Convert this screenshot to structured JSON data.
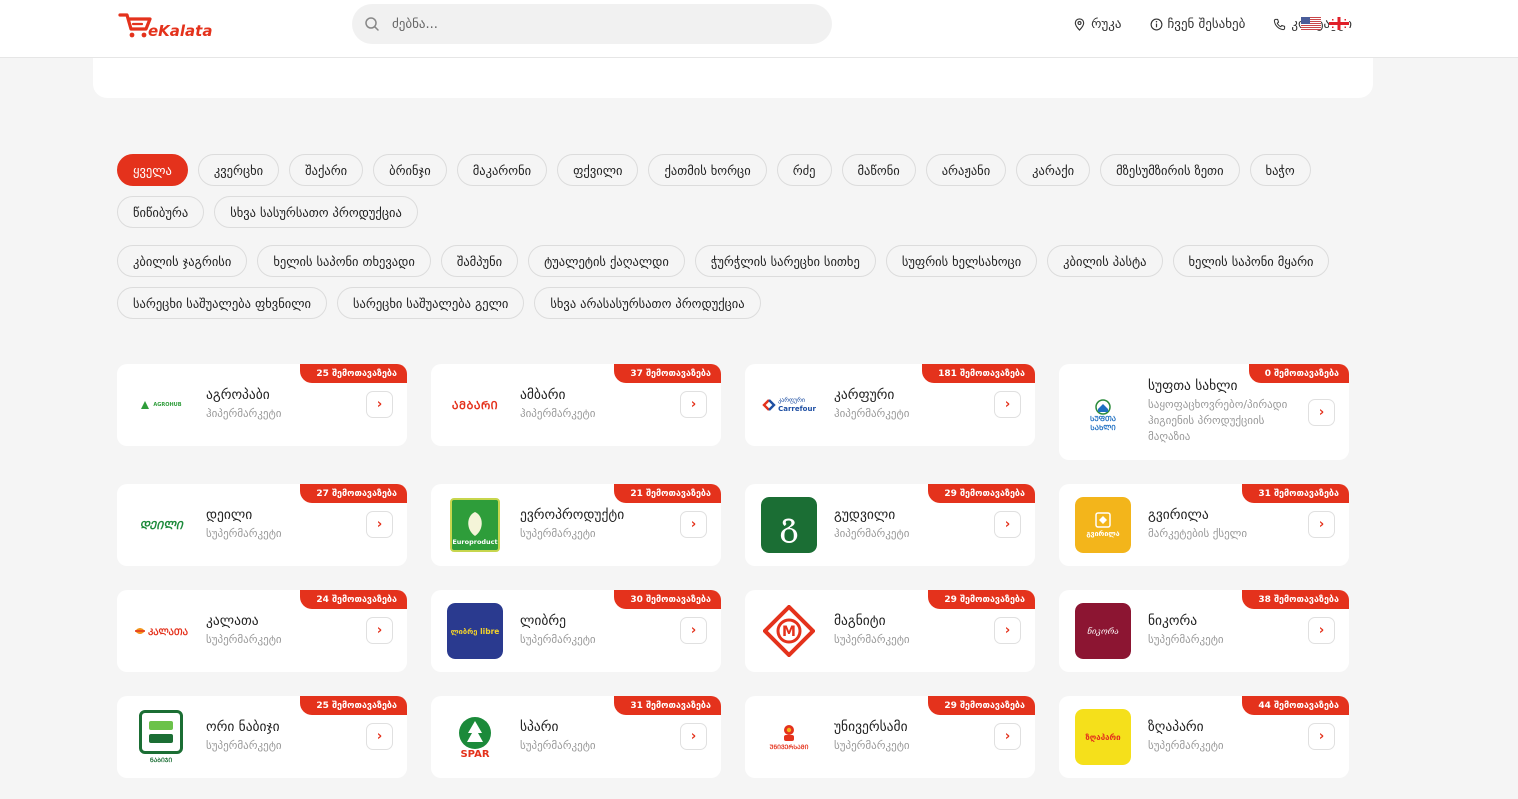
{
  "header": {
    "brand": "eKalata",
    "search_placeholder": "ძებნა...",
    "nav": [
      {
        "label": "რუკა",
        "icon": "map-pin-icon"
      },
      {
        "label": "ჩვენ შესახებ",
        "icon": "info-icon"
      },
      {
        "label": "კონტაქტი",
        "icon": "phone-icon"
      }
    ],
    "languages": [
      "en-flag-icon",
      "ge-flag-icon"
    ]
  },
  "colors": {
    "accent": "#e4321c",
    "background": "#f5f5f5"
  },
  "food_categories": [
    {
      "label": "ყველა",
      "active": true
    },
    {
      "label": "კვერცხი"
    },
    {
      "label": "შაქარი"
    },
    {
      "label": "ბრინჯი"
    },
    {
      "label": "მაკარონი"
    },
    {
      "label": "ფქვილი"
    },
    {
      "label": "ქათმის ხორცი"
    },
    {
      "label": "რძე"
    },
    {
      "label": "მაწონი"
    },
    {
      "label": "არაჟანი"
    },
    {
      "label": "კარაქი"
    },
    {
      "label": "მზესუმზირის ზეთი"
    },
    {
      "label": "ხაჭო"
    },
    {
      "label": "წიწიბურა"
    },
    {
      "label": "სხვა სასურსათო პროდუქცია"
    }
  ],
  "nonfood_categories": [
    {
      "label": "კბილის ჯაგრისი"
    },
    {
      "label": "ხელის საპონი თხევადი"
    },
    {
      "label": "შამპუნი"
    },
    {
      "label": "ტუალეტის ქაღალდი"
    },
    {
      "label": "ჭურჭლის სარეცხი სითხე"
    },
    {
      "label": "სუფრის ხელსახოცი"
    },
    {
      "label": "კბილის პასტა"
    },
    {
      "label": "ხელის საპონი მყარი"
    },
    {
      "label": "სარეცხი საშუალება ფხვნილი"
    },
    {
      "label": "სარეცხი საშუალება გელი"
    },
    {
      "label": "სხვა არასასურსათო პროდუქცია"
    }
  ],
  "stores": [
    {
      "name": "აგროპაბი",
      "type": "ჰიპერმარკეტი",
      "badge": "25 შემოთავაზება",
      "logo": "agrohub-logo",
      "logo_text": "AGROHUB"
    },
    {
      "name": "ამბარი",
      "type": "ჰიპერმარკეტი",
      "badge": "37 შემოთავაზება",
      "logo": "ambari-logo",
      "logo_text": "ᲐᲛᲑᲐᲠᲘ"
    },
    {
      "name": "კარფური",
      "type": "ჰიპერმარკეტი",
      "badge": "181 შემოთავაზება",
      "logo": "carrefour-logo",
      "logo_text": "კარფური",
      "logo_text2": "Carrefour"
    },
    {
      "name": "სუფთა სახლი",
      "type": "საყოფაცხოვრებო/პირადი ჰიგიენის პროდუქციის მაღაზია",
      "badge": "0 შემოთავაზება",
      "logo": "supta-sakhli-logo",
      "logo_text": "ᲡᲣᲤᲗᲐ",
      "logo_text2": "ᲡᲐᲮᲚᲘ"
    },
    {
      "name": "დეილი",
      "type": "სუპერმარკეტი",
      "badge": "27 შემოთავაზება",
      "logo": "daily-logo",
      "logo_text": "ᲓᲔᲘᲚᲘ"
    },
    {
      "name": "ევროპროდუქტი",
      "type": "სუპერმარკეტი",
      "badge": "21 შემოთავაზება",
      "logo": "europroduct-logo",
      "logo_text": "Europroduct"
    },
    {
      "name": "გუდვილი",
      "type": "ჰიპერმარკეტი",
      "badge": "29 შემოთავაზება",
      "logo": "goodwill-logo",
      "logo_text": "გ"
    },
    {
      "name": "გვირილა",
      "type": "მარკეტების ქსელი",
      "badge": "31 შემოთავაზება",
      "logo": "gvirila-logo",
      "logo_text": "გვირილა"
    },
    {
      "name": "კალათა",
      "type": "სუპერმარკეტი",
      "badge": "24 შემოთავაზება",
      "logo": "kalata-logo",
      "logo_text": "ᲙᲐᲚᲐᲗᲐ"
    },
    {
      "name": "ლიბრე",
      "type": "სუპერმარკეტი",
      "badge": "30 შემოთავაზება",
      "logo": "libre-logo",
      "logo_text": "ლიბრე libre"
    },
    {
      "name": "მაგნიტი",
      "type": "სუპერმარკეტი",
      "badge": "29 შემოთავაზება",
      "logo": "magniti-logo",
      "logo_text": "M"
    },
    {
      "name": "ნიკორა",
      "type": "სუპერმარკეტი",
      "badge": "38 შემოთავაზება",
      "logo": "nikora-logo",
      "logo_text": "ნიკორა"
    },
    {
      "name": "ორი ნაბიჯი",
      "type": "სუპერმარკეტი",
      "badge": "25 შემოთავაზება",
      "logo": "ori-nabiji-logo",
      "logo_text": "ᲜᲐᲑᲘᲯᲘ"
    },
    {
      "name": "სპარი",
      "type": "სუპერმარკეტი",
      "badge": "31 შემოთავაზება",
      "logo": "spar-logo",
      "logo_text": "SPAR"
    },
    {
      "name": "უნივერსამი",
      "type": "სუპერმარკეტი",
      "badge": "29 შემოთავაზება",
      "logo": "universami-logo",
      "logo_text": "ᲣᲜᲘᲕᲔᲠᲡᲐᲛᲘ"
    },
    {
      "name": "ზღაპარი",
      "type": "სუპერმარკეტი",
      "badge": "44 შემოთავაზება",
      "logo": "zgapari-logo",
      "logo_text": "ზღაპარი"
    }
  ]
}
